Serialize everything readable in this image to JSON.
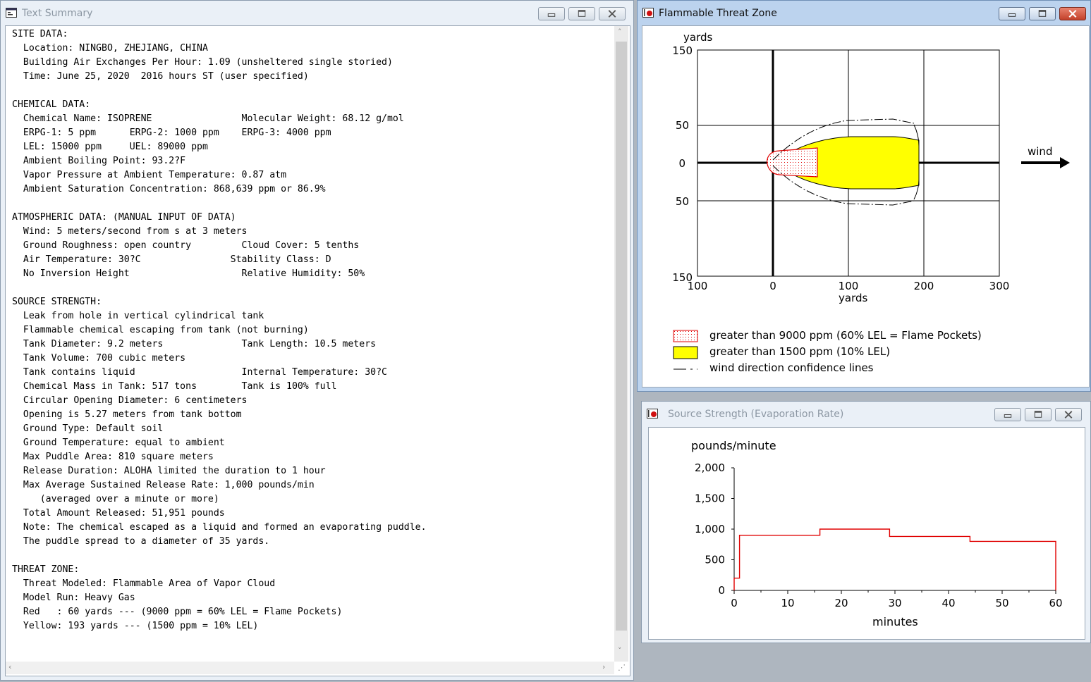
{
  "text_summary": {
    "title": "Text Summary",
    "lines": [
      "SITE DATA:",
      "  Location: NINGBO, ZHEJIANG, CHINA",
      "  Building Air Exchanges Per Hour: 1.09 (unsheltered single storied)",
      "  Time: June 25, 2020  2016 hours ST (user specified)",
      "",
      "CHEMICAL DATA:",
      "  Chemical Name: ISOPRENE                Molecular Weight: 68.12 g/mol",
      "  ERPG-1: 5 ppm      ERPG-2: 1000 ppm    ERPG-3: 4000 ppm",
      "  LEL: 15000 ppm     UEL: 89000 ppm",
      "  Ambient Boiling Point: 93.2?F",
      "  Vapor Pressure at Ambient Temperature: 0.87 atm",
      "  Ambient Saturation Concentration: 868,639 ppm or 86.9%",
      "",
      "ATMOSPHERIC DATA: (MANUAL INPUT OF DATA)",
      "  Wind: 5 meters/second from s at 3 meters",
      "  Ground Roughness: open country         Cloud Cover: 5 tenths",
      "  Air Temperature: 30?C                Stability Class: D",
      "  No Inversion Height                    Relative Humidity: 50%",
      "",
      "SOURCE STRENGTH:",
      "  Leak from hole in vertical cylindrical tank",
      "  Flammable chemical escaping from tank (not burning)",
      "  Tank Diameter: 9.2 meters              Tank Length: 10.5 meters",
      "  Tank Volume: 700 cubic meters",
      "  Tank contains liquid                   Internal Temperature: 30?C",
      "  Chemical Mass in Tank: 517 tons        Tank is 100% full",
      "  Circular Opening Diameter: 6 centimeters",
      "  Opening is 5.27 meters from tank bottom",
      "  Ground Type: Default soil",
      "  Ground Temperature: equal to ambient",
      "  Max Puddle Area: 810 square meters",
      "  Release Duration: ALOHA limited the duration to 1 hour",
      "  Max Average Sustained Release Rate: 1,000 pounds/min",
      "     (averaged over a minute or more)",
      "  Total Amount Released: 51,951 pounds",
      "  Note: The chemical escaped as a liquid and formed an evaporating puddle.",
      "  The puddle spread to a diameter of 35 yards.",
      "",
      "THREAT ZONE:",
      "  Threat Modeled: Flammable Area of Vapor Cloud",
      "  Model Run: Heavy Gas",
      "  Red   : 60 yards --- (9000 ppm = 60% LEL = Flame Pockets)",
      "  Yellow: 193 yards --- (1500 ppm = 10% LEL)"
    ]
  },
  "threat_zone": {
    "title": "Flammable Threat Zone",
    "y_unit": "yards",
    "x_unit": "yards",
    "wind_label": "wind",
    "x_ticks": [
      "100",
      "0",
      "100",
      "200",
      "300"
    ],
    "y_ticks": [
      "150",
      "50",
      "0",
      "50",
      "150"
    ],
    "legend": [
      {
        "label": "greater than 9000 ppm (60% LEL = Flame Pockets)",
        "swatch": "red-dotted"
      },
      {
        "label": "greater than 1500 ppm (10% LEL)",
        "swatch": "yellow"
      },
      {
        "label": "wind direction confidence lines",
        "swatch": "dash-line"
      }
    ],
    "colors": {
      "red": "#e00000",
      "yellow": "#ffff00"
    }
  },
  "source_strength": {
    "title": "Source Strength (Evaporation Rate)",
    "chart_data": {
      "type": "line",
      "xlabel": "minutes",
      "ylabel": "pounds/minute",
      "xlim": [
        0,
        60
      ],
      "ylim": [
        0,
        2000
      ],
      "x_ticks": [
        0,
        10,
        20,
        30,
        40,
        50,
        60
      ],
      "y_ticks": [
        0,
        500,
        1000,
        1500,
        2000
      ],
      "y_tick_labels": [
        "0",
        "500",
        "1,000",
        "1,500",
        "2,000"
      ],
      "series": [
        {
          "color": "#e00000",
          "step": true,
          "x": [
            0,
            0,
            1,
            1,
            16,
            16,
            29,
            29,
            44,
            44,
            60,
            60
          ],
          "y": [
            0,
            200,
            200,
            900,
            900,
            1000,
            1000,
            880,
            880,
            800,
            800,
            0
          ]
        }
      ]
    }
  }
}
